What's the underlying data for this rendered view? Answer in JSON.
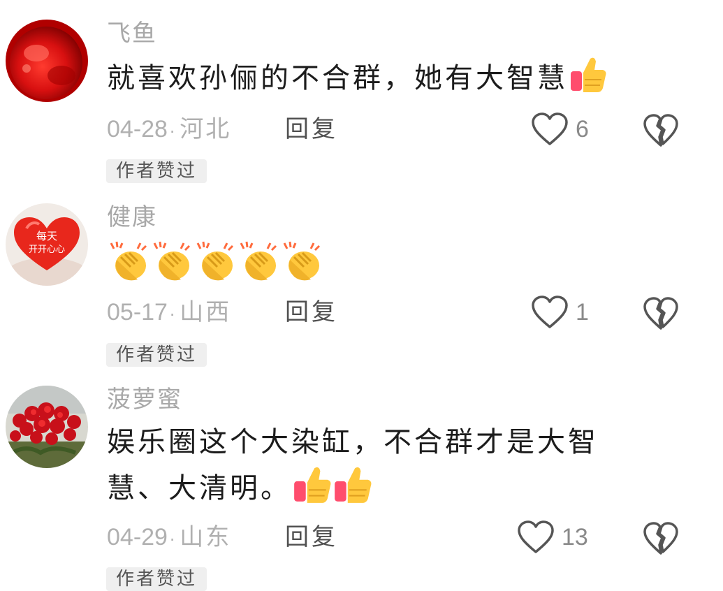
{
  "comments": [
    {
      "author": "飞鱼",
      "text": "就喜欢孙俪的不合群，她有大智慧",
      "emoji": [
        "thumbs-up"
      ],
      "date": "04-28",
      "location": "河北",
      "reply_label": "回复",
      "like_count": "6",
      "badge": "作者赞过",
      "avatar": "red-fish"
    },
    {
      "author": "健康",
      "text": "",
      "emoji": [
        "clapping-hands",
        "clapping-hands",
        "clapping-hands",
        "clapping-hands",
        "clapping-hands"
      ],
      "date": "05-17",
      "location": "山西",
      "reply_label": "回复",
      "like_count": "1",
      "badge": "作者赞过",
      "avatar": "red-heart",
      "avatar_text_1": "每天",
      "avatar_text_2": "开开心心"
    },
    {
      "author": "菠萝蜜",
      "text_line1": "娱乐圈这个大染缸，不合群才是大智",
      "text_line2": "慧、大清明。",
      "emoji": [
        "thumbs-up",
        "thumbs-up"
      ],
      "date": "04-29",
      "location": "山东",
      "reply_label": "回复",
      "like_count": "13",
      "badge": "作者赞过",
      "avatar": "red-flowers"
    }
  ],
  "dot": "·"
}
